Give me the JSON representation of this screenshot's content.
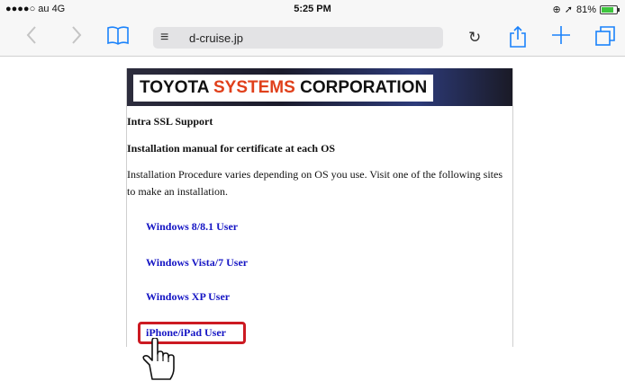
{
  "status_bar": {
    "carrier": "●●●●○ au  4G",
    "time": "5:25 PM",
    "battery_text": "81%",
    "battery_level": 0.81,
    "battery_color": "#3ec53e"
  },
  "toolbar": {
    "url": "d-cruise.jp",
    "icons": [
      "back-icon",
      "forward-icon",
      "bookmarks-icon",
      "reader-icon",
      "reload-icon",
      "share-icon",
      "new-tab-icon",
      "tabs-icon"
    ],
    "accent": "#1a82fb"
  },
  "page": {
    "logo_part1": "TOYOTA",
    "logo_part2": "SYSTEMS",
    "logo_part3": "CORPORATION",
    "logo_accent": "#e0401b",
    "heading": "Intra SSL Support",
    "subheading": "Installation manual for certificate at each OS",
    "intro": "Installation Procedure varies depending on OS you use. Visit one of the following sites to make an installation.",
    "links": [
      "Windows 8/8.1 User",
      "Windows Vista/7 User",
      "Windows XP User",
      "iPhone/iPad User"
    ],
    "link_color": "#1515c4",
    "highlight_color": "#cc1a22",
    "cursor_icon": "hand-pointer-icon"
  }
}
